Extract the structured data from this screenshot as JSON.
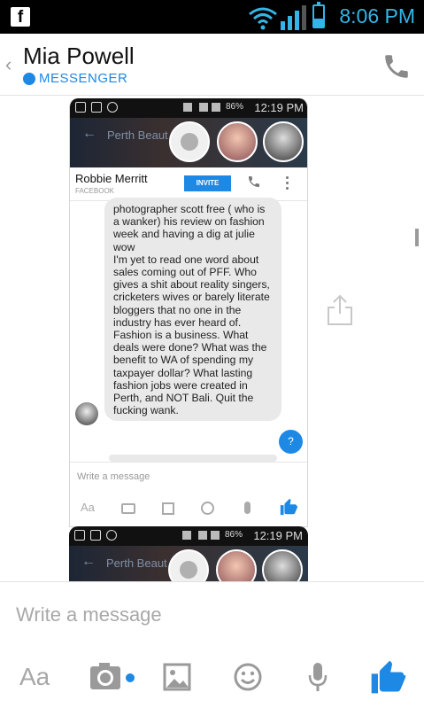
{
  "status_bar": {
    "time": "8:06 PM",
    "app_icon": "facebook-icon"
  },
  "header": {
    "title": "Mia Powell",
    "subtitle": "MESSENGER",
    "back_icon": "chevron-left-icon",
    "call_icon": "phone-icon"
  },
  "screenshot_1": {
    "status": {
      "battery_pct": "86%",
      "time": "12:19 PM"
    },
    "banner_title": "Perth Beaut",
    "contact_name": "Robbie Merritt",
    "contact_source": "FACEBOOK",
    "invite_label": "INVITE",
    "message": "photographer scott free ( who is a wanker) his review on fashion week and having a dig at julie wow\n I'm yet to read one word about sales coming out of PFF. Who gives a shit about reality singers, cricketers wives or barely literate bloggers that no one in the industry has ever heard of. Fashion is a business. What deals were done? What was the benefit to WA of spending my taxpayer dollar? What lasting fashion jobs were created in Perth, and NOT Bali. Quit the fucking wank.",
    "question_label": "?",
    "composer_placeholder": "Write a message",
    "aa_label": "Aa"
  },
  "screenshot_2": {
    "status": {
      "battery_pct": "86%",
      "time": "12:19 PM"
    },
    "banner_title": "Perth Beaut"
  },
  "composer": {
    "placeholder": "Write a message"
  },
  "bottom_bar": {
    "aa_label": "Aa"
  },
  "colors": {
    "accent": "#1e88e5",
    "status_text": "#33b5e5"
  }
}
